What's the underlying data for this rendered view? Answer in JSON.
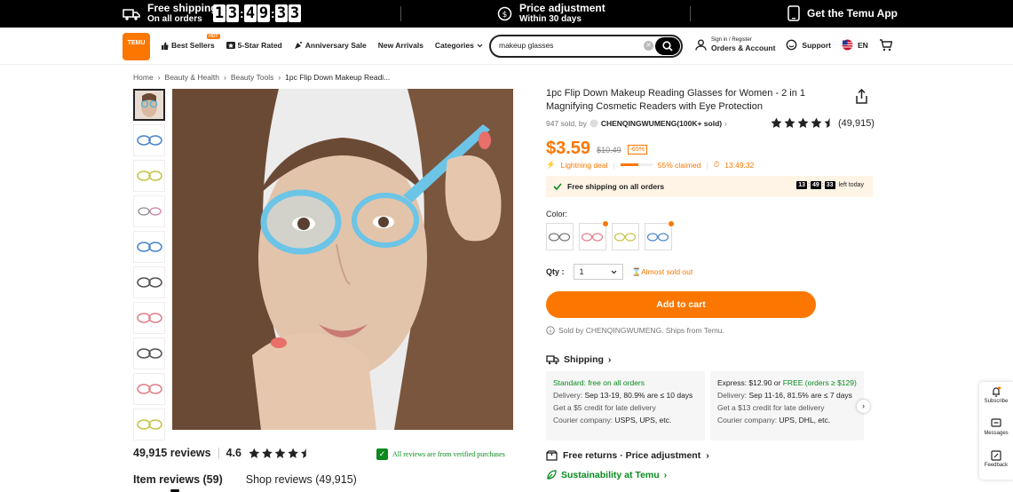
{
  "topbar": {
    "shipping_title": "Free shipping",
    "shipping_sub": "On all orders",
    "timer_digits": [
      "1",
      "3",
      "4",
      "9",
      "3",
      "3"
    ],
    "price_title": "Price adjustment",
    "price_sub": "Within 30 days",
    "app_label": "Get the Temu App"
  },
  "header": {
    "logo_text": "TEMU",
    "nav": [
      "Best Sellers",
      "5-Star Rated",
      "Anniversary Sale",
      "New Arrivals",
      "Categories"
    ],
    "hot_badge": "HOT",
    "search_value": "makeup glasses",
    "account_small": "Sign in / Register",
    "account_big": "Orders & Account",
    "support": "Support",
    "lang": "EN"
  },
  "breadcrumb": [
    "Home",
    "Beauty & Health",
    "Beauty Tools",
    "1pc Flip Down Makeup Readi..."
  ],
  "product": {
    "title": "1pc Flip Down Makeup Reading Glasses for Women - 2 in 1 Magnifying Cosmetic Readers with Eye Protection",
    "sold": "947 sold, by",
    "store": "CHENQINGWUMENG(100K+ sold)",
    "rating_count": "(49,915)",
    "price": "$3.59",
    "original_price": "$10.49",
    "discount": "-65%",
    "deal_label": "Lightning deal",
    "claimed": "55% claimed",
    "claimed_fraction": 0.55,
    "deal_timer": "13:49:32",
    "free_ship": "Free shipping on all orders",
    "countdown": [
      "13",
      "49",
      "33"
    ],
    "left_today": "left today",
    "color_label": "Color:",
    "qty_label": "Qty :",
    "qty_value": "1",
    "almost_sold": "Almost sold out",
    "cart_button": "Add to cart",
    "sold_by_note": "Sold by CHENQINGWUMENG. Ships from Temu."
  },
  "shipping": {
    "heading": "Shipping",
    "standard_title": "Standard: free on all orders",
    "standard_delivery_label": "Delivery:",
    "standard_delivery": "Sep 13-19, 80.9% are ≤ 10 days",
    "standard_credit": "Get a $5 credit for late delivery",
    "standard_courier_label": "Courier company:",
    "standard_courier": "USPS, UPS, etc.",
    "express_title_a": "Express: $12.90 or",
    "express_title_b": "FREE (orders ≥ $129)",
    "express_delivery_label": "Delivery:",
    "express_delivery": "Sep 11-16, 81.5% are ≤ 7 days",
    "express_credit": "Get a $13 credit for late delivery",
    "express_courier_label": "Courier company:",
    "express_courier": "UPS, DHL, etc."
  },
  "returns": "Free returns · Price adjustment",
  "sustainability": "Sustainability at Temu",
  "reviews": {
    "count": "49,915 reviews",
    "score": "4.6",
    "verified": "All reviews are from verified purchases",
    "tab_item": "Item reviews (59)",
    "tab_shop": "Shop reviews (49,915)"
  },
  "sidebar": [
    "Subscribe",
    "Messages",
    "Feedback"
  ]
}
